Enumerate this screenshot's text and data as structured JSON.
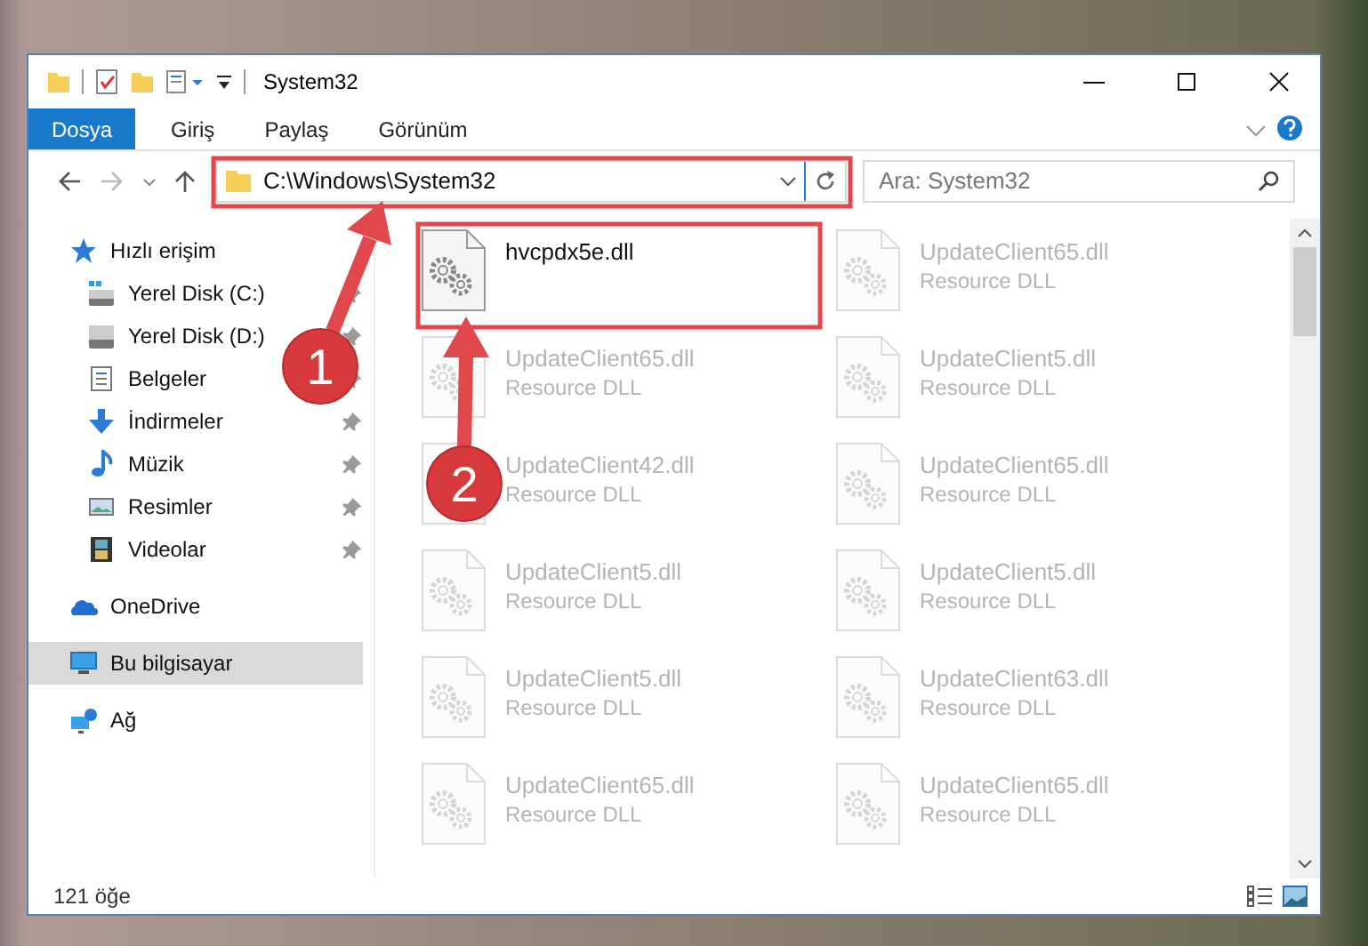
{
  "window": {
    "title": "System32"
  },
  "ribbon_tabs": [
    {
      "label": "Dosya",
      "kind": "file"
    },
    {
      "label": "Giriş",
      "kind": "tab"
    },
    {
      "label": "Paylaş",
      "kind": "tab"
    },
    {
      "label": "Görünüm",
      "kind": "tab"
    }
  ],
  "address_bar": {
    "path": "C:\\Windows\\System32"
  },
  "search": {
    "placeholder": "Ara: System32"
  },
  "sidebar": {
    "items": [
      {
        "label": "Hızlı erişim",
        "kind": "star",
        "selected": false,
        "children": [
          {
            "label": "Yerel Disk (C:)",
            "kind": "system-drive",
            "pinned": true,
            "selected": false
          },
          {
            "label": "Yerel Disk (D:)",
            "kind": "drive",
            "pinned": true,
            "selected": false
          },
          {
            "label": "Belgeler",
            "kind": "documents",
            "pinned": true,
            "selected": false
          },
          {
            "label": "İndirmeler",
            "kind": "downloads",
            "pinned": true,
            "selected": false
          },
          {
            "label": "Müzik",
            "kind": "music",
            "pinned": true,
            "selected": false
          },
          {
            "label": "Resimler",
            "kind": "pictures",
            "pinned": true,
            "selected": false
          },
          {
            "label": "Videolar",
            "kind": "videos",
            "pinned": true,
            "selected": false
          }
        ]
      },
      {
        "label": "OneDrive",
        "kind": "cloud",
        "selected": false
      },
      {
        "label": "Bu bilgisayar",
        "kind": "computer",
        "selected": true
      },
      {
        "label": "Ağ",
        "kind": "network",
        "selected": false
      }
    ]
  },
  "files": [
    {
      "name": "hvcpdx5e.dll",
      "faded": false
    },
    {
      "name": "UpdateClient65.dll",
      "type": "Resource DLL",
      "faded": true
    },
    {
      "name": "UpdateClient65.dll",
      "type": "Resource DLL",
      "faded": true
    },
    {
      "name": "UpdateClient5.dll",
      "type": "Resource DLL",
      "faded": true
    },
    {
      "name": "UpdateClient42.dll",
      "type": "Resource DLL",
      "faded": true
    },
    {
      "name": "UpdateClient65.dll",
      "type": "Resource DLL",
      "faded": true
    },
    {
      "name": "UpdateClient5.dll",
      "type": "Resource DLL",
      "faded": true
    },
    {
      "name": "UpdateClient5.dll",
      "type": "Resource DLL",
      "faded": true
    },
    {
      "name": "UpdateClient5.dll",
      "type": "Resource DLL",
      "faded": true
    },
    {
      "name": "UpdateClient63.dll",
      "type": "Resource DLL",
      "faded": true
    },
    {
      "name": "UpdateClient65.dll",
      "type": "Resource DLL",
      "faded": true
    },
    {
      "name": "UpdateClient65.dll",
      "type": "Resource DLL",
      "faded": true
    }
  ],
  "status_bar": {
    "item_count": "121 öğe"
  },
  "annotations": [
    {
      "number": "1"
    },
    {
      "number": "2"
    }
  ]
}
